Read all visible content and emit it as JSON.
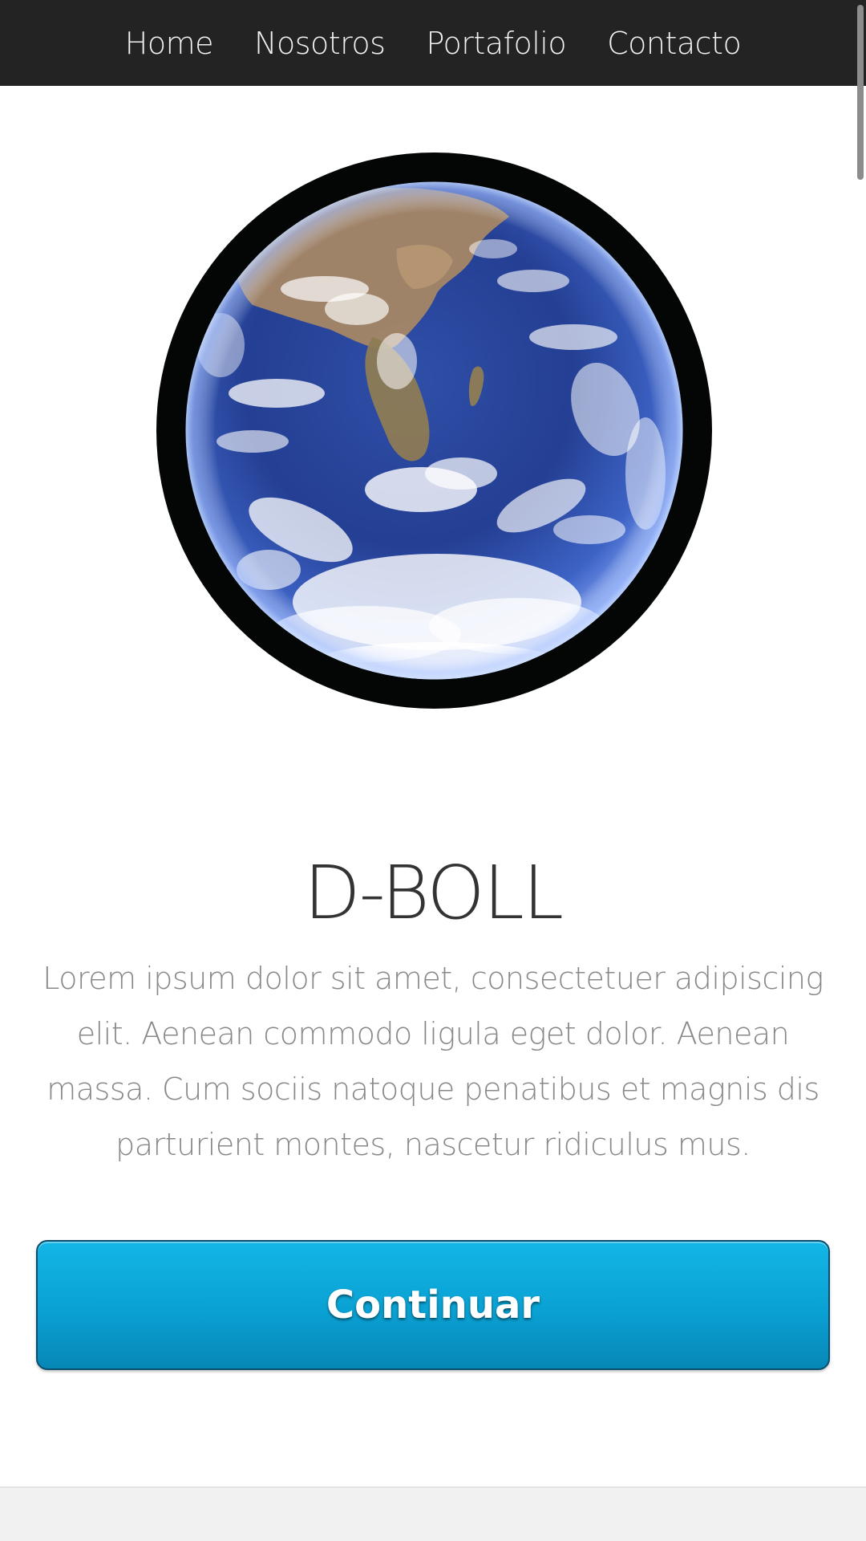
{
  "nav": {
    "items": [
      {
        "label": "Home"
      },
      {
        "label": "Nosotros"
      },
      {
        "label": "Portafolio"
      },
      {
        "label": "Contacto"
      }
    ]
  },
  "hero": {
    "image_icon": "earth-globe-image",
    "title": "D-BOLL",
    "description": "Lorem ipsum dolor sit amet, consectetuer adipiscing elit. Aenean commodo ligula eget dolor. Aenean massa. Cum sociis natoque penatibus et magnis dis parturient montes, nascetur ridiculus mus."
  },
  "cta": {
    "label": "Continuar"
  },
  "colors": {
    "navbar": "#232323",
    "button": "#0aa1d3",
    "button_border": "#0a4e6d",
    "title": "#333333",
    "body_text": "#888888"
  }
}
